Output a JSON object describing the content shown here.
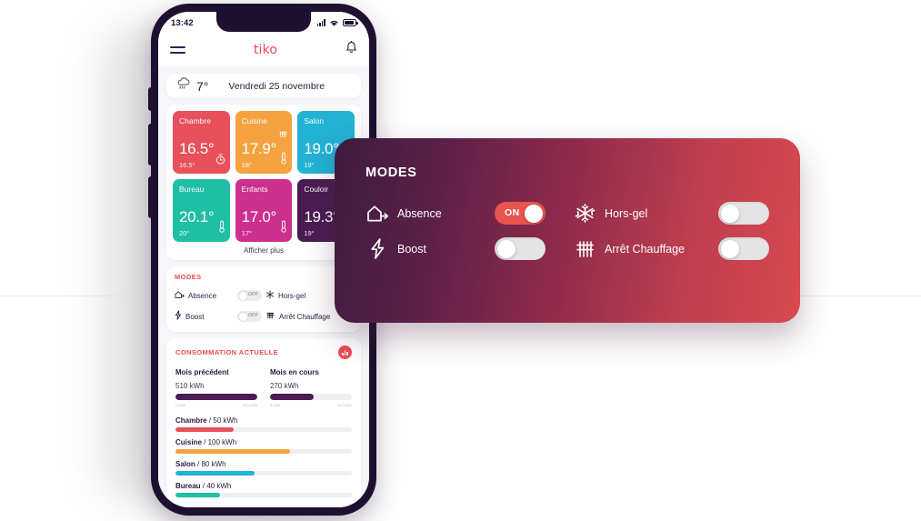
{
  "phone": {
    "status_bar": {
      "time": "13:42",
      "signal_icon": "cellular-signal-icon",
      "wifi_icon": "wifi-icon",
      "battery_icon": "battery-icon"
    },
    "app_bar": {
      "menu_icon": "hamburger-menu-icon",
      "brand": "tiko",
      "notifications_icon": "bell-icon"
    },
    "weather": {
      "icon": "rain-cloud-icon",
      "temperature": "7°",
      "date": "Vendredi 25 novembre"
    },
    "rooms": {
      "items": [
        {
          "name": "Chambre",
          "temperature": "16.5°",
          "setpoint": "16.5°",
          "color": "#e8505b",
          "icon": "timer-icon"
        },
        {
          "name": "Cuisine",
          "temperature": "17.9°",
          "setpoint": "18°",
          "color": "#f4a340",
          "icon": "thermometer-icon"
        },
        {
          "name": "Salon",
          "temperature": "19.0°",
          "setpoint": "19°",
          "color": "#22b2d4",
          "icon": "thermometer-icon"
        },
        {
          "name": "Bureau",
          "temperature": "20.1°",
          "setpoint": "20°",
          "color": "#1fbfa6",
          "icon": "thermometer-icon"
        },
        {
          "name": "Enfants",
          "temperature": "17.0°",
          "setpoint": "17°",
          "color": "#cc2f8e",
          "icon": "thermometer-icon"
        },
        {
          "name": "Couloir",
          "temperature": "19.3°",
          "setpoint": "19°",
          "color": "#4a1c53",
          "icon": "thermometer-icon"
        }
      ],
      "show_more": "Afficher plus"
    },
    "modes_mini": {
      "title": "MODES",
      "items": [
        {
          "label": "Absence",
          "state": "OFF",
          "icon": "house-exit-icon"
        },
        {
          "label": "Hors-gel",
          "state": "OFF",
          "icon": "snowflake-icon"
        },
        {
          "label": "Boost",
          "state": "OFF",
          "icon": "lightning-bolt-icon"
        },
        {
          "label": "Arrêt Chauffage",
          "state": "OFF",
          "icon": "radiator-icon"
        }
      ]
    },
    "consumption": {
      "title": "CONSOMMATION ACTUELLE",
      "badge_icon": "bar-chart-icon",
      "months": [
        {
          "label": "Mois précédent",
          "value": "510 kWh",
          "percent": 100,
          "axis_min": "0 kWh",
          "axis_max": "510 kWh"
        },
        {
          "label": "Mois en cours",
          "value": "270 kWh",
          "percent": 53,
          "axis_min": "0 kWh",
          "axis_max": "510 kWh"
        }
      ],
      "rooms": [
        {
          "name": "Chambre",
          "value": "/ 50 kWh",
          "percent": 33,
          "color": "#e8505b"
        },
        {
          "name": "Cuisine",
          "value": "/ 100 kWh",
          "percent": 65,
          "color": "#f4a340"
        },
        {
          "name": "Salon",
          "value": "/ 80 kWh",
          "percent": 45,
          "color": "#22b2d4"
        },
        {
          "name": "Bureau",
          "value": "/ 40 kWh",
          "percent": 25,
          "color": "#1fbfa6"
        }
      ]
    }
  },
  "modes_overlay": {
    "title": "MODES",
    "gradient_from": "#3d1c3f",
    "gradient_to": "#d9494f",
    "toggle_on_color": "#e8544f",
    "toggle_off_color": "#e4e4e4",
    "items": [
      {
        "label": "Absence",
        "icon": "house-exit-icon",
        "state": "on",
        "state_label": "ON"
      },
      {
        "label": "Hors-gel",
        "icon": "snowflake-icon",
        "state": "off",
        "state_label": ""
      },
      {
        "label": "Boost",
        "icon": "lightning-bolt-icon",
        "state": "off",
        "state_label": ""
      },
      {
        "label": "Arrêt Chauffage",
        "icon": "radiator-icon",
        "state": "off",
        "state_label": ""
      }
    ]
  }
}
